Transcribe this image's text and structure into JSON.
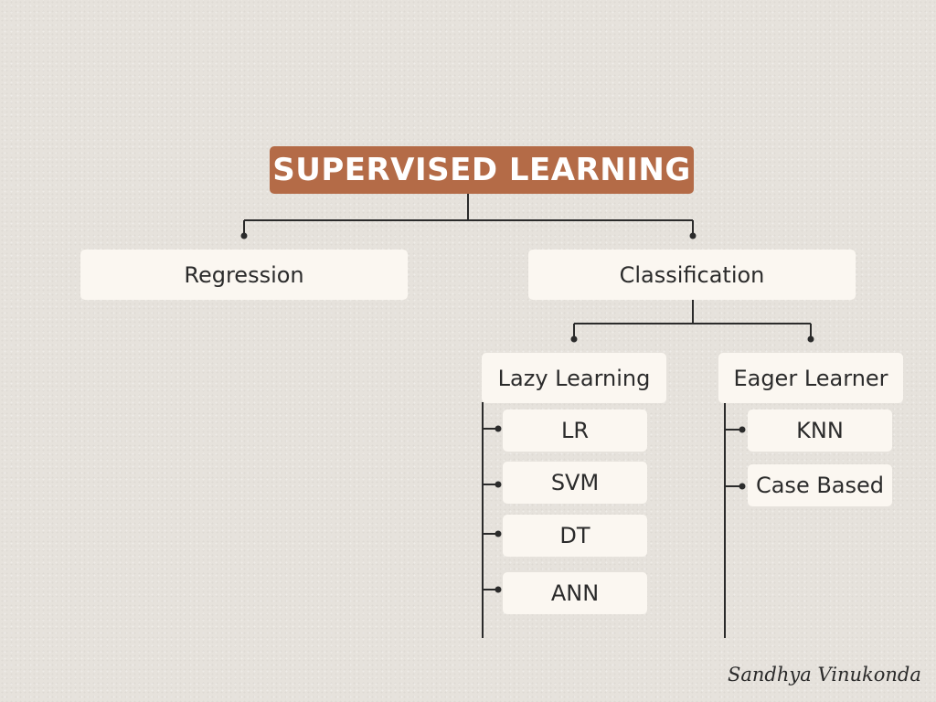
{
  "title": "SUPERVISED LEARNING",
  "branches": {
    "regression": "Regression",
    "classification": "Classification"
  },
  "classification_groups": {
    "lazy": {
      "label": "Lazy Learning",
      "items": [
        "LR",
        "SVM",
        "DT",
        "ANN"
      ]
    },
    "eager": {
      "label": "Eager Learner",
      "items": [
        "KNN",
        "Case Based"
      ]
    }
  },
  "signature": "Sandhya Vinukonda",
  "colors": {
    "background": "#e6e2dc",
    "title_fill": "#b46b47",
    "node_fill": "#fbf7f1",
    "line": "#2b2b2b"
  }
}
